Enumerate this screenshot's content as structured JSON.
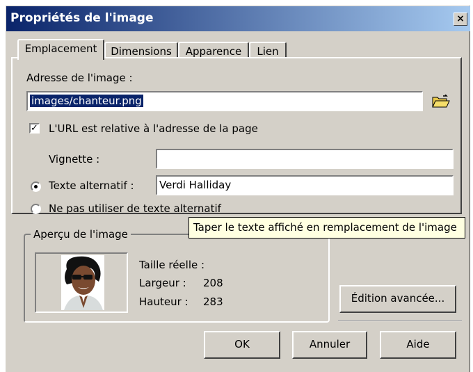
{
  "window": {
    "title": "Propriétés de l'image",
    "close_symbol": "×"
  },
  "tabs": [
    "Emplacement",
    "Dimensions",
    "Apparence",
    "Lien"
  ],
  "location": {
    "address_label": "Adresse de l'image :",
    "address_value": "images/chanteur.png",
    "relative_checkbox_label": "L'URL est relative à l'adresse de la page",
    "relative_checked": true,
    "thumbnail_label": "Vignette :",
    "thumbnail_value": "",
    "alt_radio_label": "Texte alternatif :",
    "alt_value": "Verdi Halliday",
    "no_alt_radio_label": "Ne pas utiliser de texte alternatif",
    "selected_radio": "alt"
  },
  "tooltip": "Taper le texte affiché en remplacement de l'image",
  "preview": {
    "group_title": "Aperçu de l'image",
    "real_size_label": "Taille réelle :",
    "width_label": "Largeur :",
    "width_value": "208",
    "height_label": "Hauteur :",
    "height_value": "283"
  },
  "buttons": {
    "advanced": "Édition avancée...",
    "ok": "OK",
    "cancel": "Annuler",
    "help": "Aide"
  },
  "icons": {
    "browse": "folder-open-icon",
    "close": "close-icon"
  }
}
